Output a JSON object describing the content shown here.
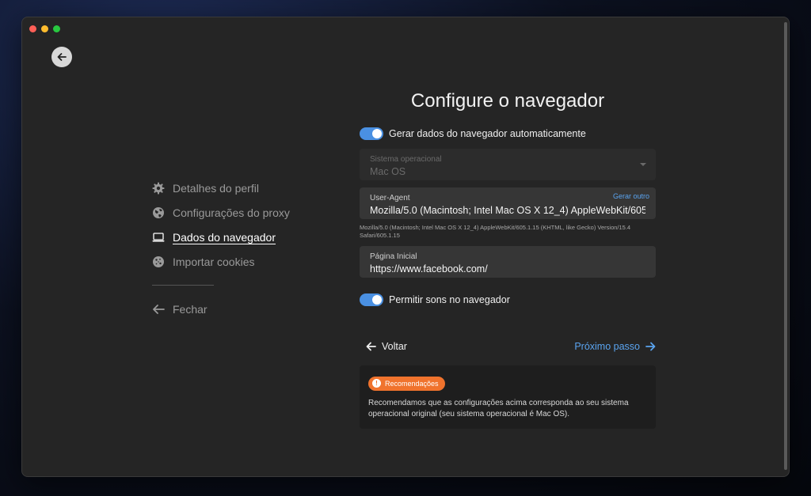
{
  "title": "Configure o navegador",
  "sidebar": {
    "items": [
      {
        "label": "Detalhes do perfil",
        "icon": "gear-icon"
      },
      {
        "label": "Configurações do proxy",
        "icon": "globe-icon"
      },
      {
        "label": "Dados do navegador",
        "icon": "laptop-icon",
        "active": true
      },
      {
        "label": "Importar cookies",
        "icon": "cookie-icon"
      }
    ],
    "close_label": "Fechar"
  },
  "auto_generate": {
    "label": "Gerar dados do navegador automaticamente",
    "enabled": true
  },
  "os_field": {
    "label": "Sistema operacional",
    "value": "Mac OS"
  },
  "user_agent": {
    "label": "User-Agent",
    "value": "Mozilla/5.0 (Macintosh; Intel Mac OS X 12_4) AppleWebKit/605.1.15 (KHTML, like Gecko) Version/15.4 Safari/605.1.15",
    "generate_label": "Gerar outro",
    "hint": "Mozilla/5.0 (Macintosh; Intel Mac OS X 12_4) AppleWebKit/605.1.15 (KHTML, like Gecko) Version/15.4 Safari/605.1.15"
  },
  "homepage": {
    "label": "Página Inicial",
    "value": "https://www.facebook.com/"
  },
  "sounds": {
    "label": "Permitir sons no navegador",
    "enabled": true
  },
  "buttons": {
    "back": "Voltar",
    "next": "Próximo passo"
  },
  "recommendation": {
    "badge": "Recomendações",
    "text": "Recomendamos que as configurações acima corresponda ao seu sistema operacional original (seu sistema operacional é Mac OS)."
  },
  "colors": {
    "accent": "#4a90e2",
    "link": "#5aa4f0",
    "badge": "#f0732d"
  }
}
